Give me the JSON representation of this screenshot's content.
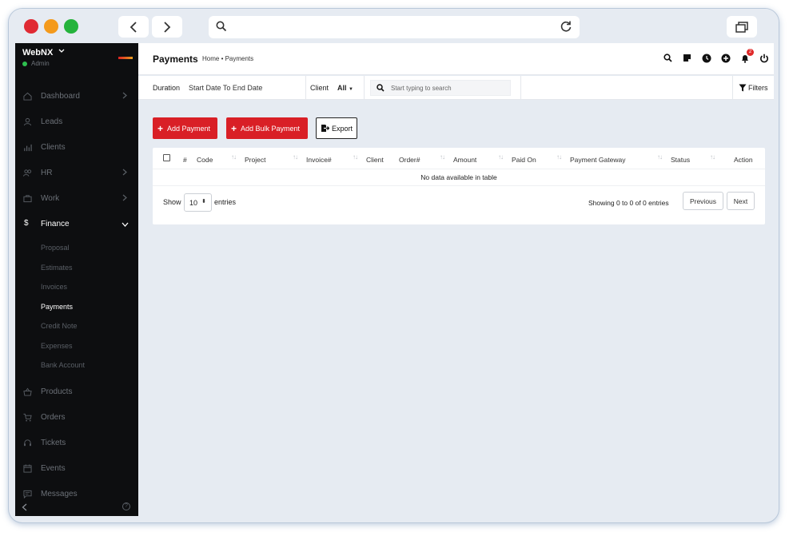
{
  "browser": {
    "icons": [
      "back-arrow-icon",
      "forward-arrow-icon",
      "search-icon",
      "reload-icon",
      "tabs-icon"
    ]
  },
  "sidebar": {
    "brand": "WebNX",
    "role": "Admin",
    "items": [
      {
        "label": "Dashboard",
        "icon": "home-icon",
        "has_arrow": true
      },
      {
        "label": "Leads",
        "icon": "user-icon",
        "has_arrow": false
      },
      {
        "label": "Clients",
        "icon": "chart-icon",
        "has_arrow": false
      },
      {
        "label": "HR",
        "icon": "users-icon",
        "has_arrow": true
      },
      {
        "label": "Work",
        "icon": "briefcase-icon",
        "has_arrow": true
      },
      {
        "label": "Finance",
        "icon": "dollar-icon",
        "has_arrow": true,
        "expanded": true
      }
    ],
    "finance_sub": [
      "Proposal",
      "Estimates",
      "Invoices",
      "Payments",
      "Credit Note",
      "Expenses",
      "Bank Account"
    ],
    "active_sub": "Payments",
    "items_after": [
      {
        "label": "Products",
        "icon": "basket-icon"
      },
      {
        "label": "Orders",
        "icon": "cart-icon"
      },
      {
        "label": "Tickets",
        "icon": "headset-icon"
      },
      {
        "label": "Events",
        "icon": "calendar-icon"
      },
      {
        "label": "Messages",
        "icon": "message-icon"
      }
    ]
  },
  "header": {
    "title": "Payments",
    "breadcrumb": "Home • Payments",
    "icons": [
      "search-icon",
      "note-icon",
      "clock-icon",
      "plus-circle-icon",
      "bell-icon",
      "power-icon"
    ],
    "notification_count": "2"
  },
  "filters": {
    "duration_label": "Duration",
    "duration_value": "Start Date To End Date",
    "client_label": "Client",
    "client_value": "All",
    "search_placeholder": "Start typing to search",
    "filters_label": "Filters"
  },
  "actions": {
    "add_payment": "Add Payment",
    "add_bulk_payment": "Add Bulk Payment",
    "export": "Export"
  },
  "table": {
    "columns": [
      "#",
      "Code",
      "Project",
      "Invoice#",
      "Client",
      "Order#",
      "Amount",
      "Paid On",
      "Payment Gateway",
      "Status",
      "Action"
    ],
    "empty_message": "No data available in table",
    "show_label": "Show",
    "page_length": "10",
    "entries_label": "entries",
    "info": "Showing 0 to 0 of 0 entries",
    "previous": "Previous",
    "next": "Next"
  },
  "colors": {
    "accent": "#d91f26",
    "sidebar_bg": "#0d0e10",
    "page_bg": "#e6ebf2"
  }
}
